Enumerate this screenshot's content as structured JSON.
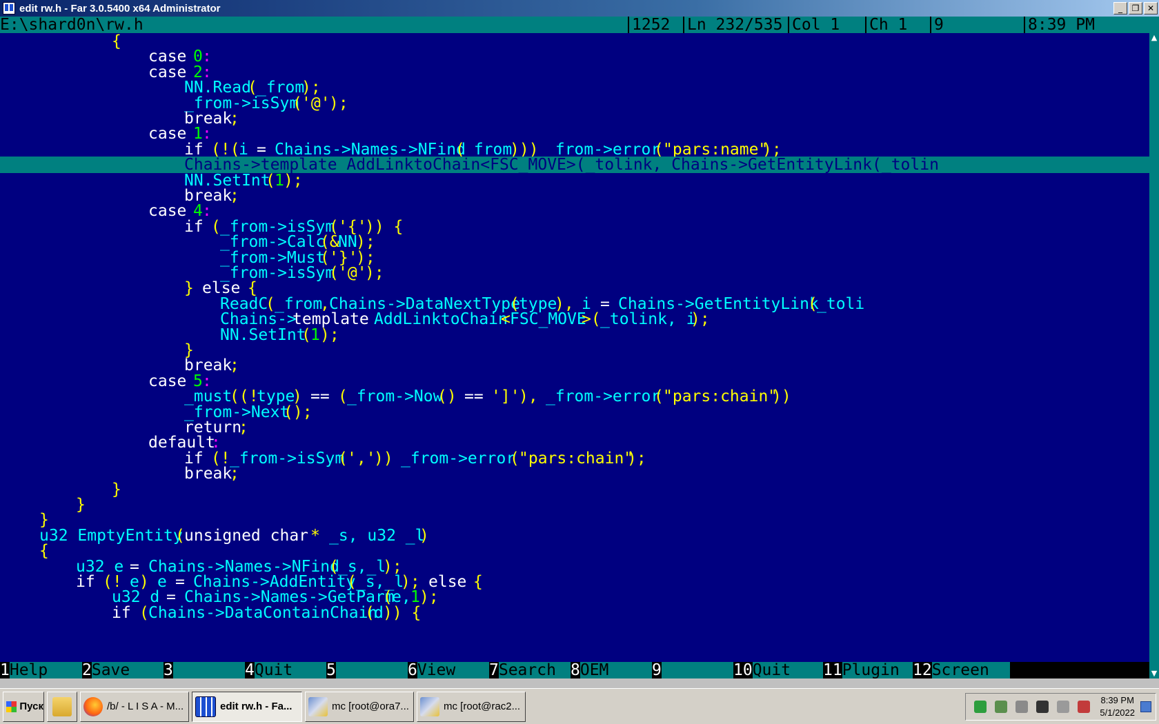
{
  "window": {
    "title": "edit rw.h - Far 3.0.5400 x64 Administrator",
    "minimize_glyph": "_",
    "restore_glyph": "❐",
    "close_glyph": "✕"
  },
  "status": {
    "path": "E:\\shard0n\\rw.h",
    "size": "1252",
    "line": "Ln 232/535",
    "col": "Col 1",
    "ch": "Ch 1",
    "code": "9",
    "time": "8:39 PM"
  },
  "editor": {
    "current_line_index": 8,
    "lines": [
      [
        [
          12,
          "pn",
          "{"
        ]
      ],
      [
        [
          16,
          "kw",
          "case "
        ],
        [
          21,
          "nm",
          "0"
        ],
        [
          22,
          "cl",
          ":"
        ]
      ],
      [
        [
          16,
          "kw",
          "case "
        ],
        [
          21,
          "nm",
          "2"
        ],
        [
          22,
          "cl",
          ":"
        ]
      ],
      [
        [
          20,
          "id",
          "NN.Read"
        ],
        [
          27,
          "pn",
          "("
        ],
        [
          28,
          "id",
          "_from"
        ],
        [
          33,
          "pn",
          ");"
        ]
      ],
      [
        [
          20,
          "id",
          "_from->isSym"
        ],
        [
          32,
          "pn",
          "("
        ],
        [
          33,
          "st",
          "'@'"
        ],
        [
          36,
          "pn",
          ");"
        ]
      ],
      [
        [
          20,
          "kw",
          "break"
        ],
        [
          25,
          "pn",
          ";"
        ]
      ],
      [
        [
          16,
          "kw",
          "case "
        ],
        [
          21,
          "nm",
          "1"
        ],
        [
          22,
          "cl",
          ":"
        ]
      ],
      [
        [
          20,
          "kw",
          "if "
        ],
        [
          23,
          "pn",
          "(!("
        ],
        [
          26,
          "id",
          "i "
        ],
        [
          28,
          "kw",
          "= "
        ],
        [
          30,
          "id",
          "Chains->Names->NFind"
        ],
        [
          50,
          "pn",
          "("
        ],
        [
          51,
          "id",
          "_from"
        ],
        [
          56,
          "pn",
          "))) "
        ],
        [
          60,
          "id",
          "_from->error"
        ],
        [
          72,
          "pn",
          "("
        ],
        [
          73,
          "st",
          "\"pars:name\""
        ],
        [
          84,
          "pn",
          ");"
        ]
      ],
      [
        [
          20,
          "id",
          "Chains->template AddLinktoChain<FSC_MOVE>(_tolink, Chains->GetEntityLink(_tolin"
        ]
      ],
      [
        [
          20,
          "id",
          "NN.SetInt"
        ],
        [
          29,
          "pn",
          "("
        ],
        [
          30,
          "nm",
          "1"
        ],
        [
          31,
          "pn",
          ");"
        ]
      ],
      [
        [
          20,
          "kw",
          "break"
        ],
        [
          25,
          "pn",
          ";"
        ]
      ],
      [
        [
          16,
          "kw",
          "case "
        ],
        [
          21,
          "nm",
          "4"
        ],
        [
          22,
          "cl",
          ":"
        ]
      ],
      [
        [
          20,
          "kw",
          "if "
        ],
        [
          23,
          "pn",
          "("
        ],
        [
          24,
          "id",
          "_from->isSym"
        ],
        [
          36,
          "pn",
          "("
        ],
        [
          37,
          "st",
          "'{'"
        ],
        [
          40,
          "pn",
          ")) {"
        ]
      ],
      [
        [
          24,
          "id",
          "_from->Calc"
        ],
        [
          35,
          "pn",
          "(&"
        ],
        [
          37,
          "id",
          "NN"
        ],
        [
          39,
          "pn",
          ");"
        ]
      ],
      [
        [
          24,
          "id",
          "_from->Must"
        ],
        [
          35,
          "pn",
          "("
        ],
        [
          36,
          "st",
          "'}'"
        ],
        [
          39,
          "pn",
          ");"
        ]
      ],
      [
        [
          24,
          "id",
          "_from->isSym"
        ],
        [
          36,
          "pn",
          "("
        ],
        [
          37,
          "st",
          "'@'"
        ],
        [
          40,
          "pn",
          ");"
        ]
      ],
      [
        [
          20,
          "pn",
          "} "
        ],
        [
          22,
          "kw",
          "else "
        ],
        [
          27,
          "pn",
          "{"
        ]
      ],
      [
        [
          24,
          "id",
          "ReadC"
        ],
        [
          29,
          "pn",
          "("
        ],
        [
          30,
          "id",
          "_from"
        ],
        [
          35,
          "pn",
          ","
        ],
        [
          36,
          "id",
          "Chains->DataNextType"
        ],
        [
          56,
          "pn",
          "("
        ],
        [
          57,
          "id",
          "type"
        ],
        [
          61,
          "pn",
          "), "
        ],
        [
          64,
          "id",
          "i "
        ],
        [
          66,
          "kw",
          "= "
        ],
        [
          68,
          "id",
          "Chains->GetEntityLink"
        ],
        [
          89,
          "pn",
          "("
        ],
        [
          90,
          "id",
          "_toli"
        ]
      ],
      [
        [
          24,
          "id",
          "Chains->"
        ],
        [
          32,
          "kw",
          "template "
        ],
        [
          41,
          "id",
          "AddLinktoChain"
        ],
        [
          55,
          "pn",
          "<"
        ],
        [
          56,
          "id",
          "FSC_MOVE"
        ],
        [
          64,
          "pn",
          ">("
        ],
        [
          66,
          "id",
          "_tolink, i"
        ],
        [
          76,
          "pn",
          ");"
        ]
      ],
      [
        [
          24,
          "id",
          "NN.SetInt"
        ],
        [
          33,
          "pn",
          "("
        ],
        [
          34,
          "nm",
          "1"
        ],
        [
          35,
          "pn",
          ");"
        ]
      ],
      [
        [
          20,
          "pn",
          "}"
        ]
      ],
      [
        [
          20,
          "kw",
          "break"
        ],
        [
          25,
          "pn",
          ";"
        ]
      ],
      [
        [
          16,
          "kw",
          "case "
        ],
        [
          21,
          "nm",
          "5"
        ],
        [
          22,
          "cl",
          ":"
        ]
      ],
      [
        [
          20,
          "id",
          "_must"
        ],
        [
          25,
          "pn",
          "((!"
        ],
        [
          28,
          "id",
          "type"
        ],
        [
          32,
          "pn",
          ") "
        ],
        [
          34,
          "kw",
          "== "
        ],
        [
          37,
          "pn",
          "("
        ],
        [
          38,
          "id",
          "_from->Now"
        ],
        [
          48,
          "pn",
          "() "
        ],
        [
          51,
          "kw",
          "== "
        ],
        [
          54,
          "st",
          "']'"
        ],
        [
          57,
          "pn",
          "), "
        ],
        [
          60,
          "id",
          "_from->error"
        ],
        [
          72,
          "pn",
          "("
        ],
        [
          73,
          "st",
          "\"pars:chain\""
        ],
        [
          85,
          "pn",
          "))"
        ]
      ],
      [
        [
          20,
          "id",
          "_from->Next"
        ],
        [
          31,
          "pn",
          "();"
        ]
      ],
      [
        [
          20,
          "kw",
          "return"
        ],
        [
          26,
          "pn",
          ";"
        ]
      ],
      [
        [
          16,
          "kw",
          "default"
        ],
        [
          23,
          "cl",
          ":"
        ]
      ],
      [
        [
          20,
          "kw",
          "if "
        ],
        [
          23,
          "pn",
          "(!"
        ],
        [
          25,
          "id",
          "_from->isSym"
        ],
        [
          37,
          "pn",
          "("
        ],
        [
          38,
          "st",
          "','"
        ],
        [
          41,
          "pn",
          ")) "
        ],
        [
          44,
          "id",
          "_from->error"
        ],
        [
          56,
          "pn",
          "("
        ],
        [
          57,
          "st",
          "\"pars:chain\""
        ],
        [
          69,
          "pn",
          ");"
        ]
      ],
      [
        [
          20,
          "kw",
          "break"
        ],
        [
          25,
          "pn",
          ";"
        ]
      ],
      [
        [
          12,
          "pn",
          "}"
        ]
      ],
      [
        [
          8,
          "pn",
          "}"
        ]
      ],
      [
        [
          4,
          "pn",
          "}"
        ]
      ],
      [
        [
          4,
          "id",
          "u32 EmptyEntity"
        ],
        [
          19,
          "pn",
          "("
        ],
        [
          20,
          "kw",
          "unsigned char "
        ],
        [
          34,
          "pn",
          "* "
        ],
        [
          36,
          "id",
          "_s, u32 _l"
        ],
        [
          46,
          "pn",
          ")"
        ]
      ],
      [
        [
          4,
          "pn",
          "{"
        ]
      ],
      [
        [
          8,
          "id",
          "u32 e "
        ],
        [
          14,
          "kw",
          "= "
        ],
        [
          16,
          "id",
          "Chains->Names->NFind"
        ],
        [
          36,
          "pn",
          "("
        ],
        [
          37,
          "id",
          "_s,_l"
        ],
        [
          42,
          "pn",
          ");"
        ]
      ],
      [
        [
          8,
          "kw",
          "if "
        ],
        [
          11,
          "pn",
          "(! "
        ],
        [
          14,
          "id",
          "e"
        ],
        [
          15,
          "pn",
          ") "
        ],
        [
          17,
          "id",
          "e "
        ],
        [
          19,
          "kw",
          "= "
        ],
        [
          21,
          "id",
          "Chains->AddEntity"
        ],
        [
          38,
          "pn",
          "("
        ],
        [
          39,
          "id",
          "_s,_l"
        ],
        [
          44,
          "pn",
          "); "
        ],
        [
          47,
          "kw",
          "else "
        ],
        [
          52,
          "pn",
          "{"
        ]
      ],
      [
        [
          12,
          "id",
          "u32 d "
        ],
        [
          18,
          "kw",
          "= "
        ],
        [
          20,
          "id",
          "Chains->Names->GetParm"
        ],
        [
          42,
          "pn",
          "("
        ],
        [
          43,
          "id",
          "e,"
        ],
        [
          45,
          "nm",
          "1"
        ],
        [
          46,
          "pn",
          ");"
        ]
      ],
      [
        [
          12,
          "kw",
          "if "
        ],
        [
          15,
          "pn",
          "("
        ],
        [
          16,
          "id",
          "Chains->DataContainChain"
        ],
        [
          40,
          "pn",
          "("
        ],
        [
          41,
          "id",
          "d"
        ],
        [
          42,
          "pn",
          ")) {"
        ]
      ]
    ]
  },
  "keybar": [
    {
      "num": "1",
      "label": "Help"
    },
    {
      "num": "2",
      "label": "Save"
    },
    {
      "num": "3",
      "label": ""
    },
    {
      "num": "4",
      "label": "Quit"
    },
    {
      "num": "5",
      "label": ""
    },
    {
      "num": "6",
      "label": "View"
    },
    {
      "num": "7",
      "label": "Search"
    },
    {
      "num": "8",
      "label": "OEM"
    },
    {
      "num": "9",
      "label": ""
    },
    {
      "num": "10",
      "label": "Quit"
    },
    {
      "num": "11",
      "label": "Plugin"
    },
    {
      "num": "12",
      "label": "Screen"
    }
  ],
  "taskbar": {
    "start_label": "Пуск",
    "buttons": [
      {
        "label": "/b/ - L I S A - M...",
        "icon": "firefox-icon",
        "active": false
      },
      {
        "label": "edit rw.h - Fa...",
        "icon": "far-icon",
        "active": true
      },
      {
        "label": "mc [root@ora7...",
        "icon": "putty-icon",
        "active": false
      },
      {
        "label": "mc [root@rac2...",
        "icon": "putty-icon",
        "active": false
      }
    ],
    "tray_icons": [
      "shield-icon",
      "network-icon",
      "computer-icon",
      "media-icon",
      "volume-icon",
      "security-icon"
    ],
    "clock_time": "8:39 PM",
    "clock_date": "5/1/2022"
  }
}
